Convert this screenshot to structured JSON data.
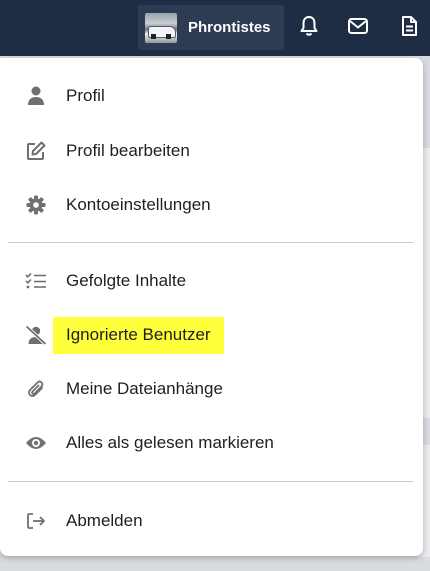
{
  "topbar": {
    "user_name": "Phrontistes",
    "avatar_icon": "avatar-car-photo",
    "icons": [
      "bell-icon",
      "envelope-icon",
      "document-icon"
    ]
  },
  "menu": {
    "items": [
      {
        "label": "Profil",
        "icon": "user-icon"
      },
      {
        "label": "Profil bearbeiten",
        "icon": "edit-icon"
      },
      {
        "label": "Kontoeinstellungen",
        "icon": "gear-icon"
      },
      {
        "label": "Gefolgte Inhalte",
        "icon": "checklist-icon"
      },
      {
        "label": "Ignorierte Benutzer",
        "icon": "user-slash-icon",
        "highlighted": true
      },
      {
        "label": "Meine Dateianhänge",
        "icon": "paperclip-icon"
      },
      {
        "label": "Alles als gelesen markieren",
        "icon": "eye-icon"
      },
      {
        "label": "Abmelden",
        "icon": "sign-out-icon"
      }
    ]
  },
  "colors": {
    "topbar_bg": "#1f2d44",
    "chip_bg": "#2d3b53",
    "highlight": "#ffff3c",
    "icon_gray": "#707070"
  }
}
